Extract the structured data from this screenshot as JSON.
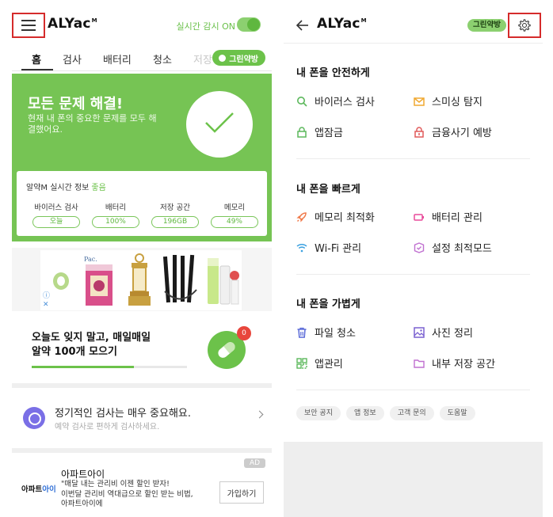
{
  "left": {
    "header": {
      "logo": "ALYac",
      "logo_mark": "M",
      "realtime_label": "실시간 감시 ON",
      "realtime_on": true
    },
    "tabs": [
      "홈",
      "검사",
      "배터리",
      "청소",
      "저장"
    ],
    "active_tab": "홈",
    "green_badge": "그린약방",
    "status": {
      "title": "모든 문제 해결!",
      "desc": "현재 내 폰의 중요한 문제를 모두 해결했어요."
    },
    "info": {
      "title": "알약M 실시간 정보",
      "status": "좋음",
      "stats": [
        {
          "label": "바이러스 검사",
          "value": "오늘"
        },
        {
          "label": "배터리",
          "value": "100%"
        },
        {
          "label": "저장 공간",
          "value": "196GB"
        },
        {
          "label": "메모리",
          "value": "49%"
        }
      ]
    },
    "ad_choice_info": "ⓘ",
    "ad_choice_close": "✕",
    "promo": {
      "line1": "오늘도 잊지 말고, 매일매일",
      "line2": "알약 100개 모으기",
      "progress": 0.66,
      "badge_count": "0"
    },
    "reminder": {
      "title": "정기적인 검사는 매우 중요해요.",
      "subtitle": "예약 검사로 편하게 검사하세요."
    },
    "ad2": {
      "logo_text": "아파트",
      "logo_accent": "아이",
      "title": "아파트아이",
      "line1": "\"매달 내는 관리비 이젠 할인 받자!",
      "line2": "이번달 관리비 역대급으로 할인 받는 비법,",
      "line3": "아파트아이에",
      "tag": "AD",
      "button": "가입하기"
    }
  },
  "right": {
    "header": {
      "logo": "ALYac",
      "logo_mark": "M",
      "tag": "그린약방"
    },
    "sections": [
      {
        "title": "내 폰을 안전하게",
        "items": [
          {
            "label": "바이러스 검사",
            "icon": "search-icon",
            "color": "#5cb85c"
          },
          {
            "label": "스미싱 탐지",
            "icon": "mail-icon",
            "color": "#f0a830"
          },
          {
            "label": "앱잠금",
            "icon": "lock-icon",
            "color": "#5cb85c"
          },
          {
            "label": "금융사기 예방",
            "icon": "alert-lock-icon",
            "color": "#e05a5a"
          }
        ]
      },
      {
        "title": "내 폰을 빠르게",
        "items": [
          {
            "label": "메모리 최적화",
            "icon": "rocket-icon",
            "color": "#f07a4a"
          },
          {
            "label": "배터리 관리",
            "icon": "battery-icon",
            "color": "#e84a9a"
          },
          {
            "label": "Wi-Fi 관리",
            "icon": "wifi-icon",
            "color": "#3aa0e0"
          },
          {
            "label": "설정 최적모드",
            "icon": "shield-check-icon",
            "color": "#c070d0"
          }
        ]
      },
      {
        "title": "내 폰을 가볍게",
        "items": [
          {
            "label": "파일 청소",
            "icon": "trash-icon",
            "color": "#5a6ad8"
          },
          {
            "label": "사진 정리",
            "icon": "image-icon",
            "color": "#7a60d0"
          },
          {
            "label": "앱관리",
            "icon": "grid-icon",
            "color": "#5cb85c"
          },
          {
            "label": "내부 저장 공간",
            "icon": "folder-icon",
            "color": "#c070d0"
          }
        ]
      }
    ],
    "footer_links": [
      "보안 공지",
      "앱 정보",
      "고객 문의",
      "도움말"
    ]
  },
  "colors": {
    "brand_green": "#76c454",
    "highlight_red": "#d52b2b"
  }
}
